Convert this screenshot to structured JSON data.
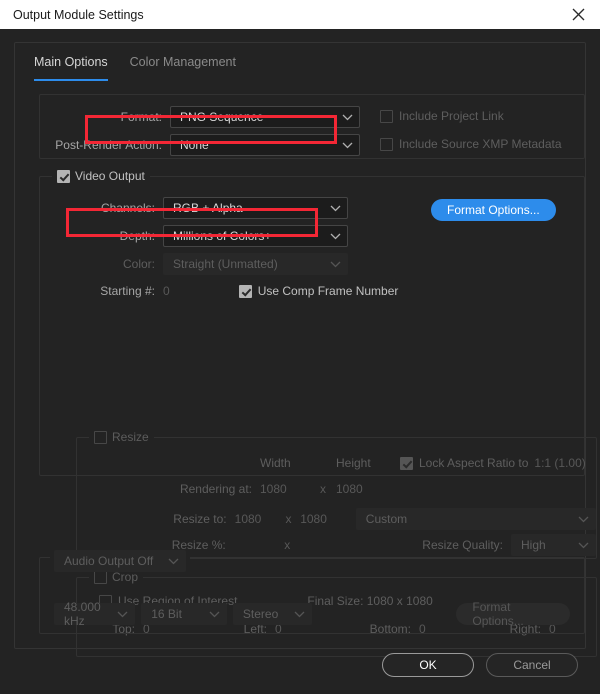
{
  "window": {
    "title": "Output Module Settings",
    "close_icon": "close-icon"
  },
  "tabs": [
    {
      "label": "Main Options",
      "active": true
    },
    {
      "label": "Color Management",
      "active": false
    }
  ],
  "format_section": {
    "format_label": "Format:",
    "format_value": "PNG Sequence",
    "post_render_label": "Post-Render Action:",
    "post_render_value": "None",
    "include_project_link": "Include Project Link",
    "include_xmp": "Include Source XMP Metadata"
  },
  "video_output": {
    "legend": "Video Output",
    "channels_label": "Channels:",
    "channels_value": "RGB + Alpha",
    "depth_label": "Depth:",
    "depth_value": "Millions of Colors+",
    "color_label": "Color:",
    "color_value": "Straight (Unmatted)",
    "starting_label": "Starting #:",
    "starting_value": "0",
    "use_comp_frame_number": "Use Comp Frame Number",
    "format_options_button": "Format Options..."
  },
  "resize": {
    "legend": "Resize",
    "width_header": "Width",
    "height_header": "Height",
    "lock_aspect": "Lock Aspect Ratio to",
    "lock_aspect_value": "1:1 (1.00)",
    "rendering_at_label": "Rendering at:",
    "rendering_width": "1080",
    "rendering_height": "1080",
    "resize_to_label": "Resize to:",
    "resize_to_width": "1080",
    "resize_to_height": "1080",
    "preset_value": "Custom",
    "resize_pct_label": "Resize %:",
    "x_separator": "x",
    "resize_quality_label": "Resize Quality:",
    "resize_quality_value": "High"
  },
  "crop": {
    "legend": "Crop",
    "use_region_of_interest": "Use Region of Interest",
    "final_size": "Final Size: 1080 x 1080",
    "top_label": "Top:",
    "top_value": "0",
    "left_label": "Left:",
    "left_value": "0",
    "bottom_label": "Bottom:",
    "bottom_value": "0",
    "right_label": "Right:",
    "right_value": "0"
  },
  "audio": {
    "output_mode": "Audio Output Off",
    "sample_rate": "48.000 kHz",
    "bit_depth": "16 Bit",
    "channels": "Stereo",
    "format_options_button": "Format Options..."
  },
  "footer": {
    "ok_label": "OK",
    "cancel_label": "Cancel"
  },
  "colors": {
    "accent_blue": "#2d8ceb",
    "annotation_red": "#f32735",
    "dialog_bg": "#232323",
    "titlebar_bg": "#ffffff"
  }
}
